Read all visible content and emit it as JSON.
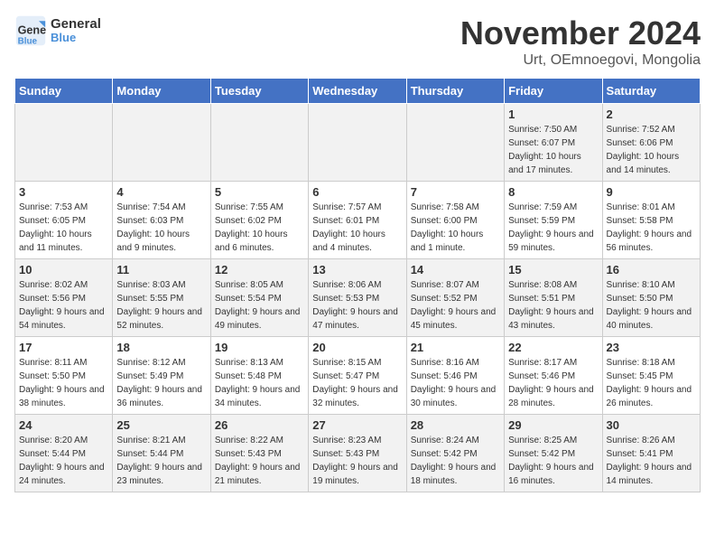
{
  "header": {
    "logo_line1": "General",
    "logo_line2": "Blue",
    "month": "November 2024",
    "location": "Urt, OEmnoegovi, Mongolia"
  },
  "weekdays": [
    "Sunday",
    "Monday",
    "Tuesday",
    "Wednesday",
    "Thursday",
    "Friday",
    "Saturday"
  ],
  "weeks": [
    [
      {
        "day": "",
        "info": ""
      },
      {
        "day": "",
        "info": ""
      },
      {
        "day": "",
        "info": ""
      },
      {
        "day": "",
        "info": ""
      },
      {
        "day": "",
        "info": ""
      },
      {
        "day": "1",
        "info": "Sunrise: 7:50 AM\nSunset: 6:07 PM\nDaylight: 10 hours and 17 minutes."
      },
      {
        "day": "2",
        "info": "Sunrise: 7:52 AM\nSunset: 6:06 PM\nDaylight: 10 hours and 14 minutes."
      }
    ],
    [
      {
        "day": "3",
        "info": "Sunrise: 7:53 AM\nSunset: 6:05 PM\nDaylight: 10 hours and 11 minutes."
      },
      {
        "day": "4",
        "info": "Sunrise: 7:54 AM\nSunset: 6:03 PM\nDaylight: 10 hours and 9 minutes."
      },
      {
        "day": "5",
        "info": "Sunrise: 7:55 AM\nSunset: 6:02 PM\nDaylight: 10 hours and 6 minutes."
      },
      {
        "day": "6",
        "info": "Sunrise: 7:57 AM\nSunset: 6:01 PM\nDaylight: 10 hours and 4 minutes."
      },
      {
        "day": "7",
        "info": "Sunrise: 7:58 AM\nSunset: 6:00 PM\nDaylight: 10 hours and 1 minute."
      },
      {
        "day": "8",
        "info": "Sunrise: 7:59 AM\nSunset: 5:59 PM\nDaylight: 9 hours and 59 minutes."
      },
      {
        "day": "9",
        "info": "Sunrise: 8:01 AM\nSunset: 5:58 PM\nDaylight: 9 hours and 56 minutes."
      }
    ],
    [
      {
        "day": "10",
        "info": "Sunrise: 8:02 AM\nSunset: 5:56 PM\nDaylight: 9 hours and 54 minutes."
      },
      {
        "day": "11",
        "info": "Sunrise: 8:03 AM\nSunset: 5:55 PM\nDaylight: 9 hours and 52 minutes."
      },
      {
        "day": "12",
        "info": "Sunrise: 8:05 AM\nSunset: 5:54 PM\nDaylight: 9 hours and 49 minutes."
      },
      {
        "day": "13",
        "info": "Sunrise: 8:06 AM\nSunset: 5:53 PM\nDaylight: 9 hours and 47 minutes."
      },
      {
        "day": "14",
        "info": "Sunrise: 8:07 AM\nSunset: 5:52 PM\nDaylight: 9 hours and 45 minutes."
      },
      {
        "day": "15",
        "info": "Sunrise: 8:08 AM\nSunset: 5:51 PM\nDaylight: 9 hours and 43 minutes."
      },
      {
        "day": "16",
        "info": "Sunrise: 8:10 AM\nSunset: 5:50 PM\nDaylight: 9 hours and 40 minutes."
      }
    ],
    [
      {
        "day": "17",
        "info": "Sunrise: 8:11 AM\nSunset: 5:50 PM\nDaylight: 9 hours and 38 minutes."
      },
      {
        "day": "18",
        "info": "Sunrise: 8:12 AM\nSunset: 5:49 PM\nDaylight: 9 hours and 36 minutes."
      },
      {
        "day": "19",
        "info": "Sunrise: 8:13 AM\nSunset: 5:48 PM\nDaylight: 9 hours and 34 minutes."
      },
      {
        "day": "20",
        "info": "Sunrise: 8:15 AM\nSunset: 5:47 PM\nDaylight: 9 hours and 32 minutes."
      },
      {
        "day": "21",
        "info": "Sunrise: 8:16 AM\nSunset: 5:46 PM\nDaylight: 9 hours and 30 minutes."
      },
      {
        "day": "22",
        "info": "Sunrise: 8:17 AM\nSunset: 5:46 PM\nDaylight: 9 hours and 28 minutes."
      },
      {
        "day": "23",
        "info": "Sunrise: 8:18 AM\nSunset: 5:45 PM\nDaylight: 9 hours and 26 minutes."
      }
    ],
    [
      {
        "day": "24",
        "info": "Sunrise: 8:20 AM\nSunset: 5:44 PM\nDaylight: 9 hours and 24 minutes."
      },
      {
        "day": "25",
        "info": "Sunrise: 8:21 AM\nSunset: 5:44 PM\nDaylight: 9 hours and 23 minutes."
      },
      {
        "day": "26",
        "info": "Sunrise: 8:22 AM\nSunset: 5:43 PM\nDaylight: 9 hours and 21 minutes."
      },
      {
        "day": "27",
        "info": "Sunrise: 8:23 AM\nSunset: 5:43 PM\nDaylight: 9 hours and 19 minutes."
      },
      {
        "day": "28",
        "info": "Sunrise: 8:24 AM\nSunset: 5:42 PM\nDaylight: 9 hours and 18 minutes."
      },
      {
        "day": "29",
        "info": "Sunrise: 8:25 AM\nSunset: 5:42 PM\nDaylight: 9 hours and 16 minutes."
      },
      {
        "day": "30",
        "info": "Sunrise: 8:26 AM\nSunset: 5:41 PM\nDaylight: 9 hours and 14 minutes."
      }
    ]
  ]
}
